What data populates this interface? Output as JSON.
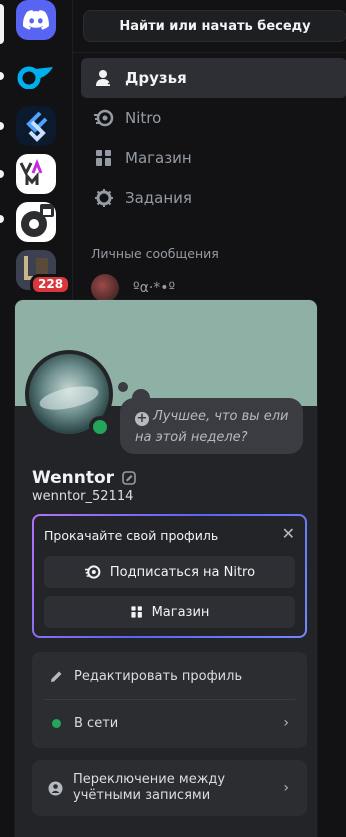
{
  "guilds": [
    {
      "name": "discord-home",
      "color": "#5865f2",
      "top": 0
    },
    {
      "name": "onlyfans-style-server",
      "color": "#121214"
    },
    {
      "name": "blue-chevron-server",
      "color": "#0c1a2e"
    },
    {
      "name": "vam-server",
      "color": "#ffffff"
    },
    {
      "name": "gear-calendar-server",
      "color": "#ffffff"
    },
    {
      "name": "game-art-server",
      "color": "#2a2e38"
    }
  ],
  "guild_badge": "228",
  "search_placeholder": "Найти или начать беседу",
  "nav": {
    "friends": "Друзья",
    "nitro": "Nitro",
    "shop": "Магазин",
    "quests": "Задания"
  },
  "dm_heading": "Личные сообщения",
  "dm_first_name": "ºα·*•º",
  "profile": {
    "banner_color": "#8fb0a5",
    "status_bubble": "Лучшее, что вы ели на этой неделе?",
    "display_name": "Wenntor",
    "username": "wenntor_52114",
    "status_color": "#23a55a"
  },
  "upsell": {
    "title": "Прокачайте свой профиль",
    "nitro_button": "Подписаться на Nitro",
    "shop_button": "Магазин"
  },
  "actions": {
    "edit_profile": "Редактировать профиль",
    "online": "В сети",
    "switch_accounts": "Переключение между учётными записями"
  },
  "colors": {
    "accent": "#5865f2",
    "online": "#23a55a",
    "badge": "#da373c"
  }
}
